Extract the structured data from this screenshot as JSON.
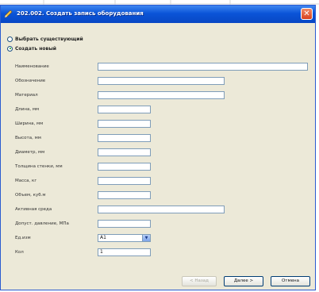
{
  "window": {
    "title": "202.002. Создать запись оборудования",
    "close_symbol": "✕"
  },
  "mode": {
    "options": [
      {
        "label": "Выбрать существующий",
        "checked": false
      },
      {
        "label": "Создать новый",
        "checked": true
      }
    ]
  },
  "fields": [
    {
      "label": "Наименование",
      "value": ""
    },
    {
      "label": "Обозначение",
      "value": ""
    },
    {
      "label": "Материал",
      "value": ""
    },
    {
      "label": "Длина, мм",
      "value": ""
    },
    {
      "label": "Ширина, мм",
      "value": ""
    },
    {
      "label": "Высота, мм",
      "value": ""
    },
    {
      "label": "Диаметр, мм",
      "value": ""
    },
    {
      "label": "Толщина стенки, мм",
      "value": ""
    },
    {
      "label": "Масса, кг",
      "value": ""
    },
    {
      "label": "Объем, куб.м",
      "value": ""
    },
    {
      "label": "Активная среда",
      "value": ""
    },
    {
      "label": "Допуст. давление, МПа",
      "value": ""
    },
    {
      "label": "Ед.изм",
      "value": "A1"
    },
    {
      "label": "Кол",
      "value": "1"
    }
  ],
  "buttons": {
    "back": "< Назад",
    "next": "Далее >",
    "cancel": "Отмена"
  },
  "colors": {
    "titlebar": "#0a54d8",
    "dialog_bg": "#ece9d8",
    "input_border": "#7f9db9",
    "close": "#d8421e"
  }
}
